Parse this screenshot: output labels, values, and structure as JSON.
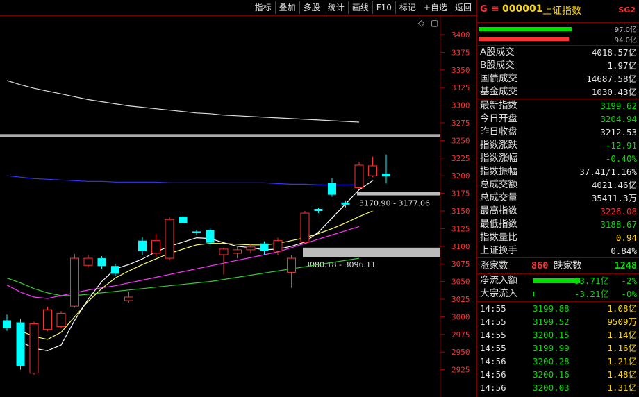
{
  "toolbar": {
    "buttons": [
      "指标",
      "叠加",
      "多股",
      "统计",
      "画线",
      "F10",
      "标记",
      "+自选",
      "返回"
    ]
  },
  "chart": {
    "y_ticks": [
      3400,
      3375,
      3350,
      3325,
      3300,
      3275,
      3250,
      3225,
      3200,
      3175,
      3150,
      3125,
      3100,
      3075,
      3050,
      3025,
      3000,
      2975,
      2950,
      2925
    ],
    "zone_label_1": "3170.90 - 3177.06",
    "zone_label_2": "3080.18 - 3096.11",
    "diamond_icon": "◇",
    "scroll_icon": "▢",
    "colors": {
      "up": "#ff3030",
      "down": "#00ffff",
      "ma5": "#ffffff",
      "ma10": "#ffff66",
      "ma20": "#ff33ff",
      "ma60": "#33cc33",
      "long": "#3333ff",
      "long2": "#dddddd"
    },
    "candles": [
      {
        "o": 2995,
        "c": 2984,
        "h": 3003,
        "l": 2980
      },
      {
        "o": 2992,
        "c": 2930,
        "h": 2997,
        "l": 2925
      },
      {
        "o": 2920,
        "c": 2990,
        "h": 2993,
        "l": 2918
      },
      {
        "o": 2982,
        "c": 3010,
        "h": 3014,
        "l": 2980
      },
      {
        "o": 2986,
        "c": 3005,
        "h": 3008,
        "l": 2984
      },
      {
        "o": 3015,
        "c": 3083,
        "h": 3089,
        "l": 3013
      },
      {
        "o": 3073,
        "c": 3083,
        "h": 3088,
        "l": 3070
      },
      {
        "o": 3083,
        "c": 3072,
        "h": 3086,
        "l": 3068
      },
      {
        "o": 3072,
        "c": 3061,
        "h": 3075,
        "l": 3058
      },
      {
        "o": 3023,
        "c": 3028,
        "h": 3036,
        "l": 3020
      },
      {
        "o": 3108,
        "c": 3093,
        "h": 3113,
        "l": 3087
      },
      {
        "o": 3090,
        "c": 3108,
        "h": 3118,
        "l": 3086
      },
      {
        "o": 3083,
        "c": 3138,
        "h": 3141,
        "l": 3080
      },
      {
        "o": 3142,
        "c": 3133,
        "h": 3148,
        "l": 3130
      },
      {
        "o": 3121,
        "c": 3119,
        "h": 3123,
        "l": 3116
      },
      {
        "o": 3123,
        "c": 3105,
        "h": 3126,
        "l": 3102
      },
      {
        "o": 3088,
        "c": 3096,
        "h": 3098,
        "l": 3060
      },
      {
        "o": 3090,
        "c": 3095,
        "h": 3099,
        "l": 3083
      },
      {
        "o": 3095,
        "c": 3099,
        "h": 3103,
        "l": 3090
      },
      {
        "o": 3104,
        "c": 3093,
        "h": 3107,
        "l": 3088
      },
      {
        "o": 3093,
        "c": 3108,
        "h": 3112,
        "l": 3088
      },
      {
        "o": 3063,
        "c": 3083,
        "h": 3087,
        "l": 3041
      },
      {
        "o": 3106,
        "c": 3147,
        "h": 3150,
        "l": 3104
      },
      {
        "o": 3153,
        "c": 3150,
        "h": 3155,
        "l": 3147
      },
      {
        "o": 3190,
        "c": 3173,
        "h": 3197,
        "l": 3170
      },
      {
        "o": 3162,
        "c": 3159,
        "h": 3165,
        "l": 3155
      },
      {
        "o": 3183,
        "c": 3215,
        "h": 3220,
        "l": 3181
      },
      {
        "o": 3200,
        "c": 3214,
        "h": 3227,
        "l": 3198
      },
      {
        "o": 3203,
        "c": 3199,
        "h": 3230,
        "l": 3189
      }
    ],
    "ma5": [
      2965,
      2955,
      2952,
      2960,
      2995,
      3025,
      3050,
      3068,
      3074,
      3082,
      3092,
      3100,
      3106,
      3112,
      3111,
      3105,
      3100,
      3098,
      3095,
      3096,
      3100,
      3106,
      3120,
      3140,
      3160,
      3180,
      3193
    ],
    "ma10": [
      2980,
      2972,
      2968,
      2978,
      3000,
      3022,
      3040,
      3055,
      3065,
      3074,
      3082,
      3090,
      3096,
      3102,
      3104,
      3104,
      3103,
      3102,
      3102,
      3104,
      3108,
      3112,
      3118,
      3125,
      3133,
      3142,
      3150
    ],
    "ma20": [
      3045,
      3035,
      3028,
      3026,
      3030,
      3034,
      3038,
      3041,
      3044,
      3048,
      3052,
      3056,
      3060,
      3064,
      3068,
      3072,
      3076,
      3080,
      3084,
      3088,
      3092,
      3098,
      3104,
      3110,
      3116,
      3122,
      3128
    ],
    "ma60": [
      3055,
      3048,
      3040,
      3034,
      3030,
      3030,
      3032,
      3034,
      3036,
      3038,
      3040,
      3042,
      3044,
      3046,
      3048,
      3050,
      3053,
      3056,
      3059,
      3062,
      3065,
      3068,
      3071,
      3074,
      3077,
      3080,
      3083
    ],
    "long": [
      3200,
      3198,
      3196,
      3195,
      3194,
      3193,
      3192,
      3192,
      3191,
      3191,
      3191,
      3191,
      3190,
      3190,
      3190,
      3190,
      3190,
      3190,
      3190,
      3190,
      3189,
      3188,
      3188,
      3187,
      3187,
      3187,
      3187
    ],
    "long2": [
      3335,
      3329,
      3324,
      3320,
      3316,
      3312,
      3308,
      3305,
      3302,
      3299,
      3297,
      3295,
      3293,
      3291,
      3289,
      3288,
      3286,
      3285,
      3284,
      3283,
      3282,
      3281,
      3280,
      3279,
      3278,
      3277,
      3276
    ]
  },
  "quote": {
    "g_label": "G",
    "menu_icon": "≡",
    "code": "000001",
    "name": "上证指数",
    "badge": "SG2",
    "bar1_val": "97.0亿",
    "bar2_val": "94.0亿",
    "bar1_frac": 0.96,
    "bar2_frac": 0.93,
    "rows_a": [
      {
        "label": "A股成交",
        "value": "4018.57亿",
        "cls": "w"
      },
      {
        "label": "B股成交",
        "value": "1.97亿",
        "cls": "w"
      },
      {
        "label": "国债成交",
        "value": "14687.58亿",
        "cls": "w"
      },
      {
        "label": "基金成交",
        "value": "1030.43亿",
        "cls": "w"
      }
    ],
    "rows_b": [
      {
        "label": "最新指数",
        "value": "3199.62",
        "cls": "gr"
      },
      {
        "label": "今日开盘",
        "value": "3204.94",
        "cls": "gr"
      },
      {
        "label": "昨日收盘",
        "value": "3212.53",
        "cls": "w"
      },
      {
        "label": "指数涨跌",
        "value": "-12.91",
        "cls": "gr"
      },
      {
        "label": "指数涨幅",
        "value": "-0.40%",
        "cls": "gr"
      },
      {
        "label": "指数振幅",
        "value": "37.41/1.16%",
        "cls": "w"
      },
      {
        "label": "总成交额",
        "value": "4021.46亿",
        "cls": "w"
      },
      {
        "label": "总成交量",
        "value": "35411.3万",
        "cls": "w"
      },
      {
        "label": "最高指数",
        "value": "3226.08",
        "cls": "r"
      },
      {
        "label": "最低指数",
        "value": "3188.67",
        "cls": "gr"
      },
      {
        "label": "指数量比",
        "value": "0.94",
        "cls": "y"
      },
      {
        "label": "上证换手",
        "value": "0.84%",
        "cls": "w"
      }
    ],
    "rise_label": "涨家数",
    "rise_value": "860",
    "fall_label": "跌家数",
    "fall_value": "1248",
    "flow": [
      {
        "label": "净流入额",
        "value": "-93.71亿",
        "pct": "-2%",
        "frac": 0.95
      },
      {
        "label": "大宗流入",
        "value": "-3.21亿",
        "pct": "-0%",
        "frac": 0.02
      }
    ],
    "ticks": [
      {
        "time": "14:55",
        "price": "3199.88",
        "vol": "1.08亿"
      },
      {
        "time": "14:55",
        "price": "3199.52",
        "vol": "9509万"
      },
      {
        "time": "14:55",
        "price": "3200.15",
        "vol": "1.14亿"
      },
      {
        "time": "14:55",
        "price": "3199.99",
        "vol": "1.16亿"
      },
      {
        "time": "14:56",
        "price": "3200.28",
        "vol": "1.21亿"
      },
      {
        "time": "14:56",
        "price": "3200.16",
        "vol": "1.48亿"
      },
      {
        "time": "14:56",
        "price": "3200.03",
        "vol": "1.31亿"
      }
    ]
  }
}
